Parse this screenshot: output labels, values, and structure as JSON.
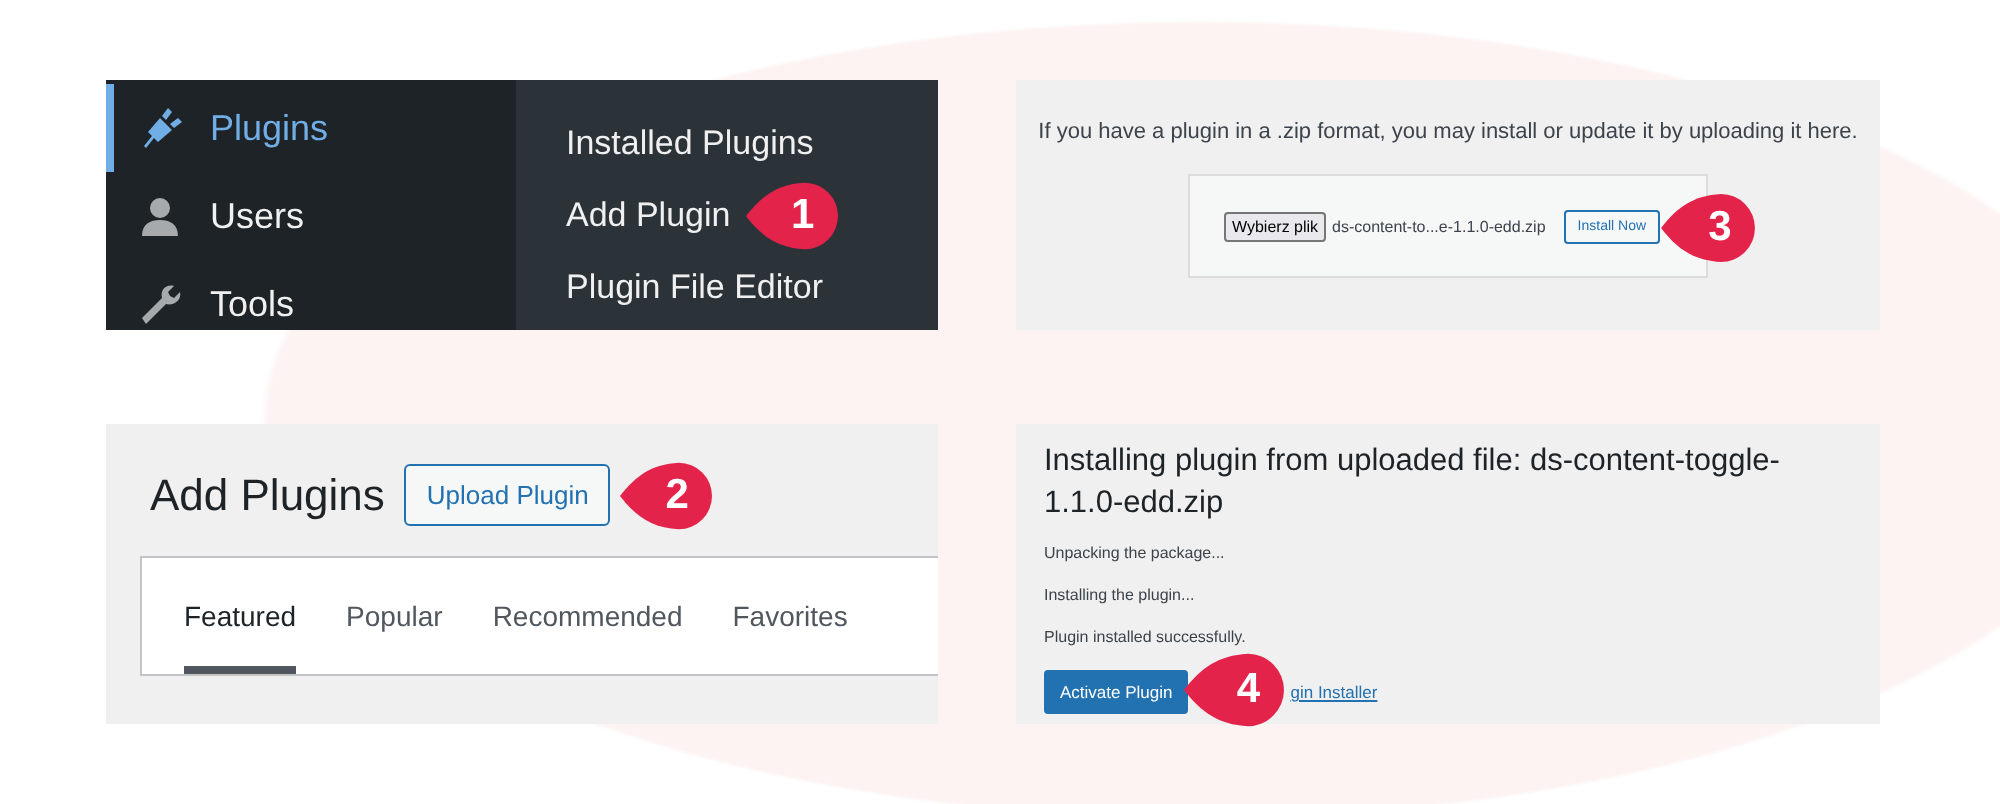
{
  "menu_panel": {
    "sidebar": [
      {
        "label": "Plugins",
        "selected": true
      },
      {
        "label": "Users",
        "selected": false
      },
      {
        "label": "Tools",
        "selected": false
      }
    ],
    "submenu": [
      {
        "label": "Installed Plugins"
      },
      {
        "label": "Add Plugin",
        "callout": "1"
      },
      {
        "label": "Plugin File Editor"
      }
    ]
  },
  "upload_panel": {
    "description": "If you have a plugin in a .zip format, you may install or update it by uploading it here.",
    "file_button": "Wybierz plik",
    "file_name": "ds-content-to...e-1.1.0-edd.zip",
    "install_button": "Install Now",
    "callout": "3"
  },
  "add_plugins_panel": {
    "title": "Add Plugins",
    "upload_button": "Upload Plugin",
    "callout": "2",
    "tabs": [
      {
        "label": "Featured",
        "selected": true
      },
      {
        "label": "Popular",
        "selected": false
      },
      {
        "label": "Recommended",
        "selected": false
      },
      {
        "label": "Favorites",
        "selected": false
      }
    ]
  },
  "install_panel": {
    "title": "Installing plugin from uploaded file: ds-content-toggle-1.1.0-edd.zip",
    "messages": [
      "Unpacking the package...",
      "Installing the plugin...",
      "Plugin installed successfully."
    ],
    "activate_button": "Activate Plugin",
    "callout": "4",
    "link": "gin Installer"
  }
}
